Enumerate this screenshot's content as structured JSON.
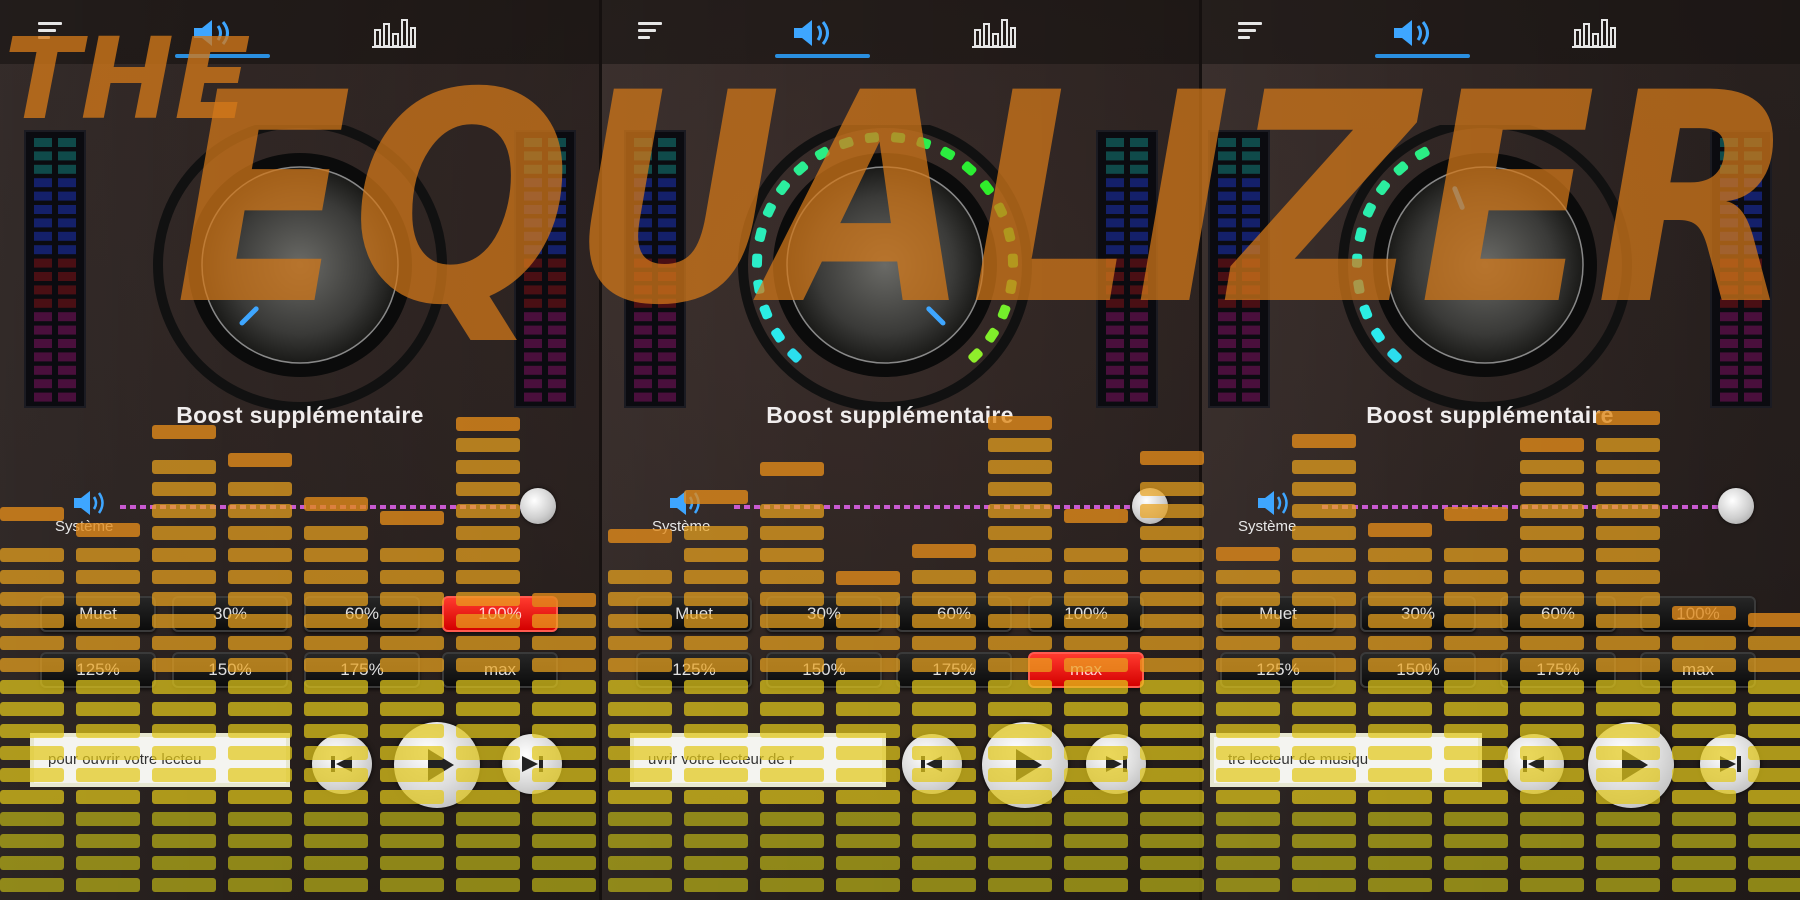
{
  "app": {
    "logo_text_small": "THE",
    "logo_text_big": "EQUALIZER",
    "accent": "#2a8fe0",
    "overlay_color": "#e8a22a"
  },
  "icons": {
    "menu": "menu-icon",
    "sound_tab": "speaker-icon",
    "eq_tab": "equalizer-bars-icon",
    "volume": "speaker-icon",
    "prev": "skip-previous-icon",
    "play": "play-icon",
    "next": "skip-next-icon"
  },
  "panels": [
    {
      "boost_label": "Boost supplémentaire",
      "system_label": "Système",
      "volume_level": 1.0,
      "knob_arc_fraction": 0.0,
      "presets": [
        "Muet",
        "30%",
        "60%",
        "100%",
        "125%",
        "150%",
        "175%",
        "max"
      ],
      "active_preset": "100%",
      "player_text": "pour ouvrir votre lecteu"
    },
    {
      "boost_label": "Boost supplémentaire",
      "system_label": "Système",
      "volume_level": 1.0,
      "knob_arc_fraction": 1.0,
      "presets": [
        "Muet",
        "30%",
        "60%",
        "100%",
        "125%",
        "150%",
        "175%",
        "max"
      ],
      "active_preset": "max",
      "player_text": "uvrir votre lecteur de r"
    },
    {
      "boost_label": "Boost supplémentaire",
      "system_label": "Système",
      "volume_level": 1.0,
      "knob_arc_fraction": 0.42,
      "presets": [
        "Muet",
        "30%",
        "60%",
        "100%",
        "125%",
        "150%",
        "175%",
        "max"
      ],
      "active_preset": "",
      "player_text": "tre lecteur de musiqu"
    }
  ]
}
